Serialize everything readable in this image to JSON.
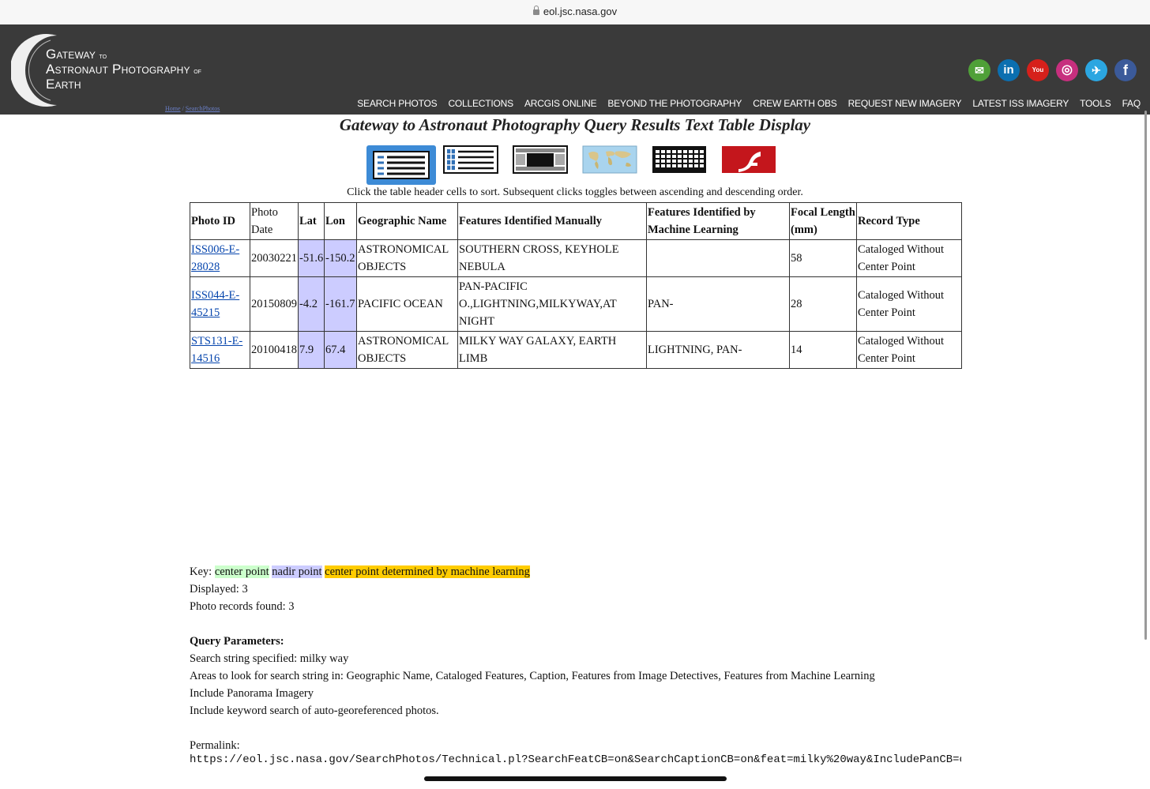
{
  "browser": {
    "url": "eol.jsc.nasa.gov"
  },
  "site": {
    "logo": {
      "word1": "Gateway",
      "to": "to",
      "word2": "Astronaut Photography",
      "of": "of",
      "word3": "Earth"
    },
    "breadcrumb": {
      "home": "Home",
      "sep": " / ",
      "search": "SearchPhotos"
    },
    "social": [
      {
        "name": "email",
        "glyph": "✉",
        "color": "#4fa038"
      },
      {
        "name": "linkedin",
        "glyph": "in",
        "color": "#0b6fb0"
      },
      {
        "name": "youtube",
        "glyph": "You",
        "color": "#d6201b"
      },
      {
        "name": "instagram",
        "glyph": "◎",
        "color": "#c72f7e"
      },
      {
        "name": "twitter",
        "glyph": "🐦",
        "color": "#2ba6e1"
      },
      {
        "name": "facebook",
        "glyph": "f",
        "color": "#3b5a9a"
      }
    ],
    "nav": [
      "SEARCH PHOTOS",
      "COLLECTIONS",
      "ARCGIS ONLINE",
      "BEYOND THE PHOTOGRAPHY",
      "CREW EARTH OBS",
      "REQUEST NEW IMAGERY",
      "LATEST ISS IMAGERY",
      "TOOLS",
      "FAQ"
    ]
  },
  "page": {
    "title": "Gateway to Astronaut Photography Query Results Text Table Display",
    "views": [
      "text-table-view",
      "list-view",
      "filmstrip-view",
      "map-view",
      "grid-view",
      "flash-view"
    ],
    "instructions": "Click the table header cells to sort. Subsequent clicks toggles between ascending and descending order."
  },
  "table": {
    "headers": [
      "Photo ID",
      "Photo Date",
      "Lat",
      "Lon",
      "Geographic Name",
      "Features Identified Manually",
      "Features Identified by Machine Learning",
      "Focal Length (mm)",
      "Record Type"
    ],
    "rows": [
      {
        "id": "ISS006-E-28028",
        "date": "20030221",
        "lat": "-51.6",
        "lon": "-150.2",
        "geo": "ASTRONOMICAL OBJECTS",
        "manual": "SOUTHERN CROSS, KEYHOLE NEBULA",
        "ml": "",
        "focal": "58",
        "record": "Cataloged Without Center Point"
      },
      {
        "id": "ISS044-E-45215",
        "date": "20150809",
        "lat": "-4.2",
        "lon": "-161.7",
        "geo": "PACIFIC OCEAN",
        "manual": "PAN-PACIFIC O.,LIGHTNING,MILKYWAY,AT NIGHT",
        "ml": "PAN-",
        "focal": "28",
        "record": "Cataloged Without Center Point"
      },
      {
        "id": "STS131-E-14516",
        "date": "20100418",
        "lat": "7.9",
        "lon": "67.4",
        "geo": "ASTRONOMICAL OBJECTS",
        "manual": "MILKY WAY GALAXY, EARTH LIMB",
        "ml": "LIGHTNING, PAN-",
        "focal": "14",
        "record": "Cataloged Without Center Point"
      }
    ]
  },
  "footer": {
    "key_label": "Key:",
    "key_center": "center point",
    "key_nadir": "nadir point",
    "key_ml": "center point determined by machine learning",
    "displayed": "Displayed: 3",
    "found": "Photo records found: 3",
    "query_heading": "Query Parameters:",
    "search_string": "Search string specified: milky way",
    "areas": "Areas to look for search string in: Geographic Name, Cataloged Features, Caption, Features from Image Detectives, Features from Machine Learning",
    "panorama": "Include Panorama Imagery",
    "keyword": "Include keyword search of auto-georeferenced photos.",
    "permalink_label": "Permalink:",
    "permalink_url": "https://eol.jsc.nasa.gov/SearchPhotos/Technical.pl?SearchFeatCB=on&SearchCaptionCB=on&feat=milky%20way&IncludePanCB=on&SearchGe"
  }
}
